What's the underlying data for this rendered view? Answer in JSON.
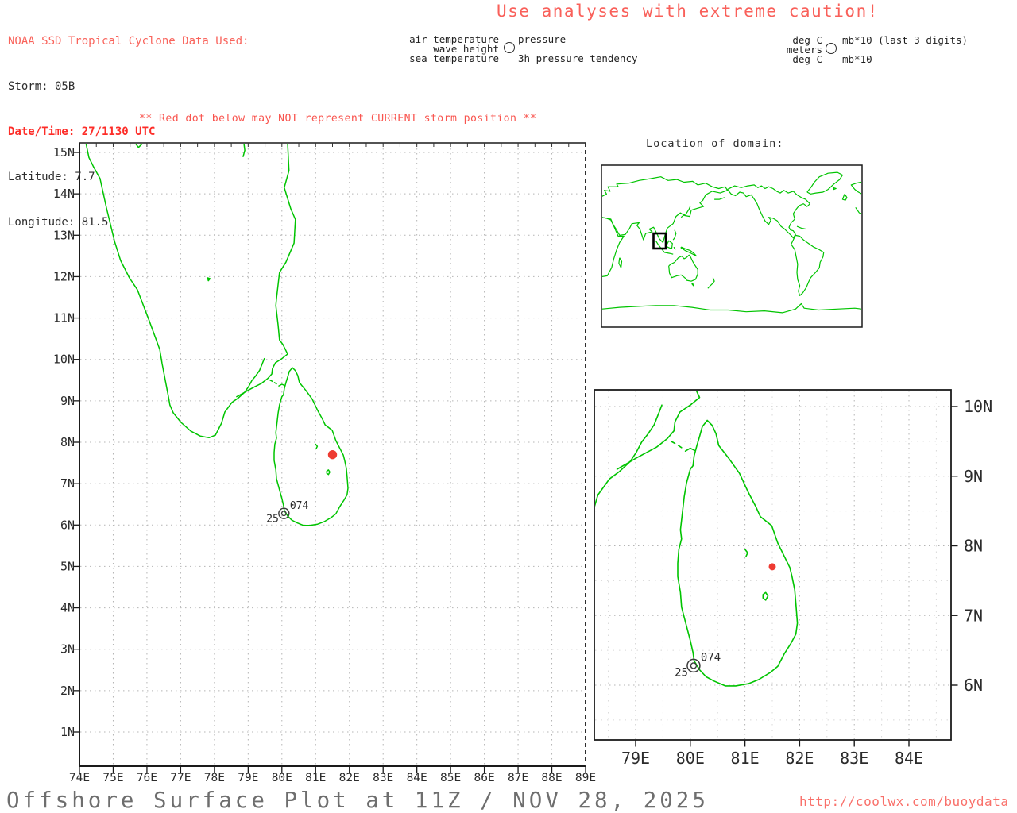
{
  "header": {
    "source_line": "NOAA SSD Tropical Cyclone Data Used:",
    "storm": "Storm: 05B",
    "datetime": "Date/Time: 27/1130 UTC",
    "latitude": "Latitude: 7.7",
    "longitude": "Longitude: 81.5",
    "caution": "Use analyses with extreme caution!"
  },
  "legend": {
    "left": {
      "air": "air temperature",
      "pressure": "pressure",
      "wave": "wave height",
      "sea": "sea temperature",
      "tendency": "3h pressure tendency"
    },
    "right": {
      "degc_top": "deg C",
      "mb_top": "mb*10 (last 3 digits)",
      "meters": "meters",
      "degc_bottom": "deg C",
      "mb_bottom": "mb*10"
    }
  },
  "warning": "** Red dot below may NOT represent CURRENT storm position **",
  "main_map": {
    "x_tick_labels": [
      "74E",
      "75E",
      "76E",
      "77E",
      "78E",
      "79E",
      "80E",
      "81E",
      "82E",
      "83E",
      "84E",
      "85E",
      "86E",
      "87E",
      "88E",
      "89E"
    ],
    "y_tick_labels": [
      "15N",
      "14N",
      "13N",
      "12N",
      "11N",
      "10N",
      "9N",
      "8N",
      "7N",
      "6N",
      "5N",
      "4N",
      "3N",
      "2N",
      "1N"
    ],
    "station": {
      "id": "074",
      "value": "25",
      "lon": 80.06,
      "lat": 6.28
    },
    "storm_dot": {
      "lon": 81.5,
      "lat": 7.7
    }
  },
  "inset_world": {
    "title": "Location of domain:"
  },
  "inset_zoom": {
    "x_tick_labels": [
      "79E",
      "80E",
      "81E",
      "82E",
      "83E",
      "84E"
    ],
    "y_tick_labels": [
      "10N",
      "9N",
      "8N",
      "7N",
      "6N"
    ],
    "station": {
      "id": "074",
      "value": "25",
      "lon": 80.06,
      "lat": 6.28
    },
    "storm_dot": {
      "lon": 81.5,
      "lat": 7.7
    }
  },
  "footer": {
    "title": "Offshore Surface Plot at 11Z / NOV 28, 2025",
    "url": "http://coolwx.com/buoydata"
  },
  "colors": {
    "coast": "#00c400",
    "alert_red": "#f9605a",
    "strong_red": "#fd2d28",
    "grid": "#b4b4b4",
    "grid_minor": "#d8d8d8",
    "ink": "#2e2e2e",
    "title_gray": "#6e6e6e",
    "storm_dot_red": "#ee3b32"
  }
}
